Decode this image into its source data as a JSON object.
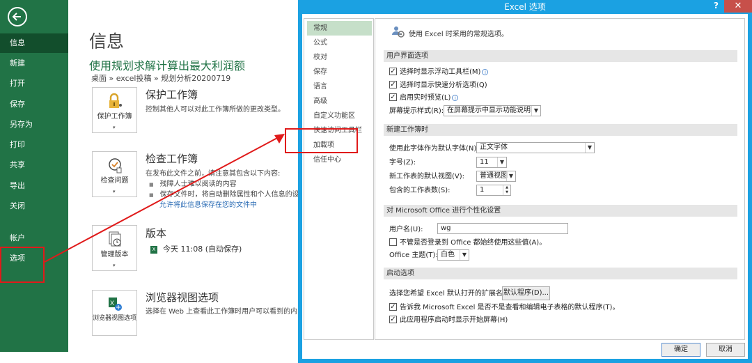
{
  "backstage": {
    "nav": [
      {
        "label": "信息",
        "active": true
      },
      {
        "label": "新建"
      },
      {
        "label": "打开"
      },
      {
        "label": "保存"
      },
      {
        "label": "另存为"
      },
      {
        "label": "打印"
      },
      {
        "label": "共享"
      },
      {
        "label": "导出"
      },
      {
        "label": "关闭"
      },
      {
        "label": "帐户"
      },
      {
        "label": "选项"
      }
    ],
    "page_title": "信息",
    "doc_title": "使用规划求解计算出最大利润额",
    "breadcrumb": "桌面 » excel投稿 » 规划分析20200719",
    "sections": {
      "protect": {
        "button": "保护工作簿",
        "title": "保护工作簿",
        "desc": "控制其他人可以对此工作簿所做的更改类型。"
      },
      "inspect": {
        "button": "检查问题",
        "title": "检查工作簿",
        "desc": "在发布此文件之前，请注意其包含以下内容:",
        "bullets": [
          "残障人士难以阅读的内容",
          "保存文件时，将自动删除属性和个人信息的设置"
        ],
        "link": "允许将此信息保存在您的文件中"
      },
      "versions": {
        "button": "管理版本",
        "title": "版本",
        "entry": "今天 11:08 (自动保存)"
      },
      "browser": {
        "button": "浏览器视图选项",
        "title": "浏览器视图选项",
        "desc": "选择在 Web 上查看此工作簿时用户可以看到的内"
      }
    }
  },
  "dialog": {
    "title": "Excel 选项",
    "help": "?",
    "close": "✕",
    "categories": [
      {
        "label": "常规",
        "active": true
      },
      {
        "label": "公式"
      },
      {
        "label": "校对"
      },
      {
        "label": "保存"
      },
      {
        "label": "语言"
      },
      {
        "label": "高级"
      },
      {
        "label": "自定义功能区"
      },
      {
        "label": "快速访问工具栏"
      },
      {
        "label": "加载项"
      },
      {
        "label": "信任中心"
      }
    ],
    "header": "使用 Excel 时采用的常规选项。",
    "groups": {
      "ui": "用户界面选项",
      "new_wb": "新建工作簿时",
      "personalize": "对 Microsoft Office 进行个性化设置",
      "startup": "启动选项"
    },
    "ui_options": {
      "mini_toolbar": {
        "label": "选择时显示浮动工具栏(M)",
        "checked": true
      },
      "quick_analysis": {
        "label": "选择时显示快速分析选项(Q)",
        "checked": true
      },
      "live_preview": {
        "label": "启用实时预览(L)",
        "checked": true
      },
      "screentip_label": "屏幕提示样式(R):",
      "screentip_value": "在屏幕提示中显示功能说明"
    },
    "new_wb": {
      "font_label": "使用此字体作为默认字体(N):",
      "font_value": "正文字体",
      "size_label": "字号(Z):",
      "size_value": "11",
      "view_label": "新工作表的默认视图(V):",
      "view_value": "普通视图",
      "sheets_label": "包含的工作表数(S):",
      "sheets_value": "1"
    },
    "personalize": {
      "username_label": "用户名(U):",
      "username_value": "wg",
      "always_use": {
        "label": "不管是否登录到 Office 都始终使用这些值(A)。",
        "checked": false
      },
      "theme_label": "Office 主题(T):",
      "theme_value": "白色"
    },
    "startup": {
      "ext_label": "选择您希望 Excel 默认打开的扩展名:",
      "ext_button": "默认程序(D)...",
      "tell_default": {
        "label": "告诉我 Microsoft Excel 是否不是查看和编辑电子表格的默认程序(T)。",
        "checked": true
      },
      "show_start": {
        "label": "此应用程序启动时显示开始屏幕(H)",
        "checked": true
      }
    },
    "ok": "确定",
    "cancel": "取消"
  },
  "colors": {
    "backstage_green": "#217346",
    "dialog_title_bar": "#1ba1e2",
    "annotation_red": "#e01a1a",
    "active_category": "#c6dfc9"
  }
}
